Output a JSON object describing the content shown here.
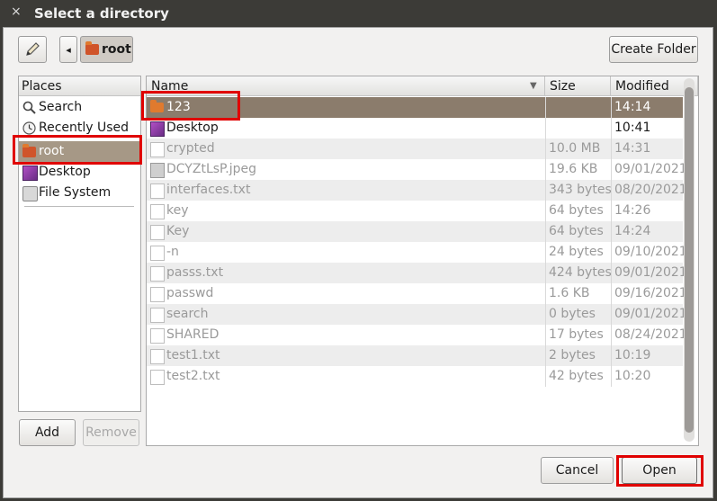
{
  "window": {
    "title": "Select a directory",
    "close_glyph": "×"
  },
  "toolbar": {
    "edit_icon": "pencil-icon",
    "back_glyph": "◂",
    "path_button_label": "root",
    "create_folder_label": "Create Folder"
  },
  "places": {
    "header": "Places",
    "items": [
      {
        "label": "Search",
        "icon": "search-icon"
      },
      {
        "label": "Recently Used",
        "icon": "clock-icon"
      },
      {
        "label": "root",
        "icon": "home-folder-icon",
        "selected": true
      },
      {
        "label": "Desktop",
        "icon": "desktop-icon"
      },
      {
        "label": "File System",
        "icon": "drive-icon"
      }
    ],
    "add_label": "Add",
    "remove_label": "Remove"
  },
  "files": {
    "columns": {
      "name": "Name",
      "size": "Size",
      "modified": "Modified",
      "sort_glyph": "▼"
    },
    "rows": [
      {
        "name": "123",
        "size": "",
        "modified": "14:14",
        "type": "folder",
        "selected": true
      },
      {
        "name": "Desktop",
        "size": "",
        "modified": "10:41",
        "type": "desktop"
      },
      {
        "name": "crypted",
        "size": "10.0 MB",
        "modified": "14:31",
        "type": "file"
      },
      {
        "name": "DCYZtLsP.jpeg",
        "size": "19.6 KB",
        "modified": "09/01/2021",
        "type": "image"
      },
      {
        "name": "interfaces.txt",
        "size": "343 bytes",
        "modified": "08/20/2021",
        "type": "file"
      },
      {
        "name": "key",
        "size": "64 bytes",
        "modified": "14:26",
        "type": "file"
      },
      {
        "name": "Key",
        "size": "64 bytes",
        "modified": "14:24",
        "type": "file"
      },
      {
        "name": "-n",
        "size": "24 bytes",
        "modified": "09/10/2021",
        "type": "file"
      },
      {
        "name": "passs.txt",
        "size": "424 bytes",
        "modified": "09/01/2021",
        "type": "file"
      },
      {
        "name": "passwd",
        "size": "1.6 KB",
        "modified": "09/16/2021",
        "type": "file"
      },
      {
        "name": "search",
        "size": "0 bytes",
        "modified": "09/01/2021",
        "type": "file"
      },
      {
        "name": "SHARED",
        "size": "17 bytes",
        "modified": "08/24/2021",
        "type": "file"
      },
      {
        "name": "test1.txt",
        "size": "2 bytes",
        "modified": "10:19",
        "type": "file"
      },
      {
        "name": "test2.txt",
        "size": "42 bytes",
        "modified": "10:20",
        "type": "file"
      }
    ]
  },
  "actions": {
    "cancel_label": "Cancel",
    "open_label": "Open"
  },
  "colors": {
    "highlight_box": "#e00000",
    "selection": "#8b7c6c",
    "titlebar": "#3c3b37"
  }
}
